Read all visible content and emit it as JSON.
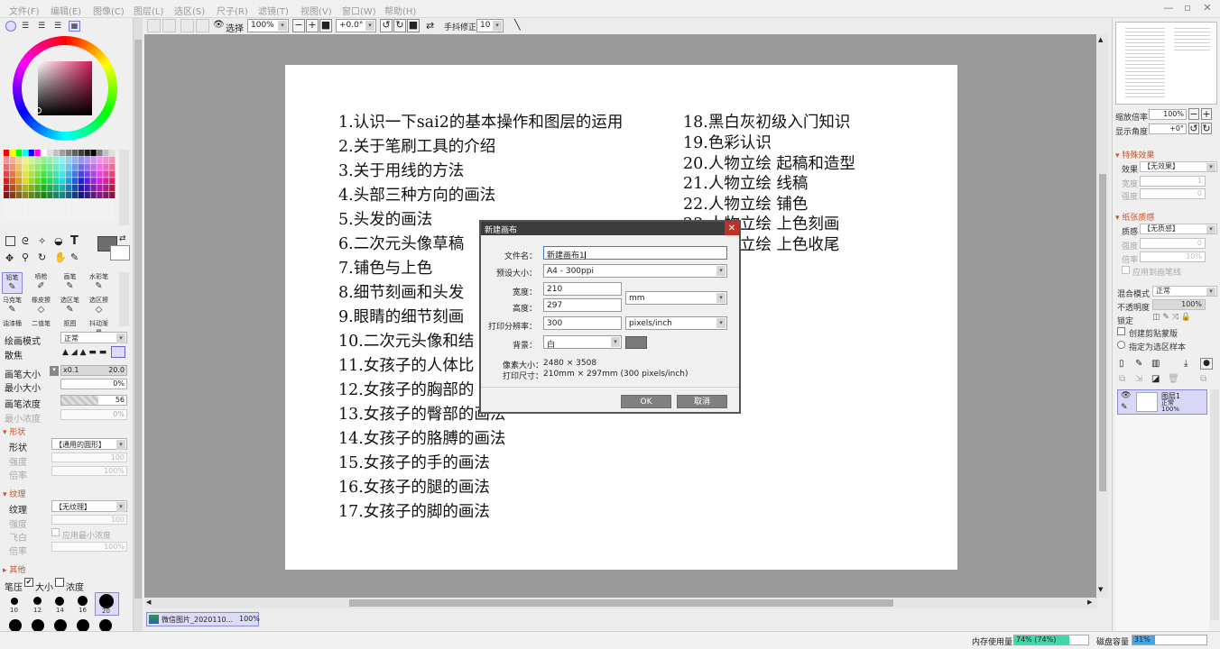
{
  "menubar": {
    "items": [
      "文件(F)",
      "编辑(E)",
      "图像(C)",
      "图层(L)",
      "选区(S)",
      "尺子(R)",
      "滤镜(T)",
      "视图(V)",
      "窗口(W)",
      "帮助(H)"
    ]
  },
  "toolbar": {
    "select_label": "选择",
    "zoom": "100%",
    "rotation": "+0.0°",
    "stabilizer_label": "手抖修正",
    "stabilizer_value": "10"
  },
  "left_panel": {
    "tools": [
      "铅笔",
      "喷枪",
      "画笔",
      "水彩笔",
      "马克笔",
      "橡皮擦",
      "选区笔",
      "选区擦",
      "油漆桶",
      "二值笔",
      "抠图",
      "抖动渐晕"
    ],
    "draw_mode_label": "绘画模式",
    "draw_mode_value": "正常",
    "scatter_label": "散焦",
    "brush_size_label": "画笔大小",
    "brush_size_mult": "x0.1",
    "brush_size_value": "20.0",
    "min_size_label": "最小大小",
    "min_size_value": "0%",
    "density_label": "画笔浓度",
    "density_value": "56",
    "min_density_label": "最小浓度",
    "min_density_value": "0%",
    "shape_section": "形状",
    "shape_label": "形状",
    "shape_value": "【通用的圆形】",
    "shape_strength_label": "强度",
    "shape_strength_value": "100",
    "shape_rate_label": "倍率",
    "shape_rate_value": "100%",
    "texture_section": "纹理",
    "texture_label": "纹理",
    "texture_value": "【无纹理】",
    "texture_strength_label": "强度",
    "texture_strength_value": "100",
    "flyin_label": "飞白",
    "flyin_check_label": "应用最小浓度",
    "texture_rate_label": "倍率",
    "texture_rate_value": "100%",
    "other_section": "其他",
    "pressure_label": "笔压",
    "pressure_size": "大小",
    "pressure_density": "浓度",
    "brush_sizes": [
      "10",
      "12",
      "14",
      "16",
      "20"
    ]
  },
  "canvas": {
    "left_items": [
      "1.认识一下sai2的基本操作和图层的运用",
      "2.关于笔刷工具的介绍",
      "3.关于用线的方法",
      "4.头部三种方向的画法",
      "5.头发的画法",
      "6.二次元头像草稿",
      "7.铺色与上色",
      "8.细节刻画和头发",
      "9.眼睛的细节刻画",
      "10.二次元头像和结",
      "11.女孩子的人体比",
      "12.女孩子的胸部的",
      "13.女孩子的臀部的画法",
      "14.女孩子的胳膊的画法",
      "15.女孩子的手的画法",
      "16.女孩子的腿的画法",
      "17.女孩子的脚的画法"
    ],
    "right_items": [
      "18.黑白灰初级入门知识",
      "19.色彩认识",
      "20.人物立绘 起稿和造型",
      "21.人物立绘 线稿",
      "22.人物立绘 铺色",
      "23.人物立绘 上色刻画",
      "24.人物立绘 上色收尾"
    ]
  },
  "dialog": {
    "title": "新建画布",
    "filename_label": "文件名：",
    "filename_value": "新建画布1",
    "preset_label": "预设大小：",
    "preset_value": "A4 - 300ppi",
    "width_label": "宽度：",
    "width_value": "210",
    "height_label": "高度：",
    "height_value": "297",
    "unit_value": "mm",
    "resolution_label": "打印分辨率：",
    "resolution_value": "300",
    "resolution_unit": "pixels/inch",
    "background_label": "背景：",
    "background_value": "白",
    "pixel_size_label": "像素大小：",
    "pixel_size_value": "2480 × 3508",
    "print_size_label": "打印尺寸：",
    "print_size_value": "210mm × 297mm (300 pixels/inch)",
    "ok_label": "OK",
    "cancel_label": "取消"
  },
  "right_panel": {
    "zoom_label": "缩放倍率",
    "zoom_value": "100%",
    "angle_label": "显示角度",
    "angle_value": "+0°",
    "effects_section": "特殊效果",
    "effect_label": "效果",
    "effect_value": "【无效果】",
    "effect_strength_label": "宽度",
    "effect_strength_value": "1",
    "effect_rate_label": "强度",
    "effect_rate_value": "0",
    "paper_section": "纸张质感",
    "paper_label": "质感",
    "paper_value": "【无质感】",
    "paper_strength_label": "强度",
    "paper_strength_value": "0",
    "paper_rate_label": "倍率",
    "paper_rate_value": "10%",
    "apply_brush_label": "应用到画笔线",
    "blend_label": "混合模式",
    "blend_value": "正常",
    "opacity_label": "不透明度",
    "opacity_value": "100%",
    "lock_label": "锁定",
    "clip_label": "创建剪贴蒙版",
    "select_source_label": "指定为选区样本",
    "layer_name": "图层1",
    "layer_mode": "正常",
    "layer_opacity": "100%"
  },
  "document_tab": {
    "name": "微信图片_2020110...",
    "zoom": "100%"
  },
  "statusbar": {
    "memory_label": "内存使用量",
    "memory_value": "74% (74%)",
    "memory_fraction": 0.74,
    "disk_label": "磁盘容量",
    "disk_value": "31%",
    "disk_fraction": 0.31
  },
  "colors": {
    "accent_green": "#3fd8a8",
    "accent_blue": "#49a6e6",
    "dialog_title": "#3c3c3c",
    "close_red": "#c0302a",
    "section_orange": "#c8522a"
  }
}
